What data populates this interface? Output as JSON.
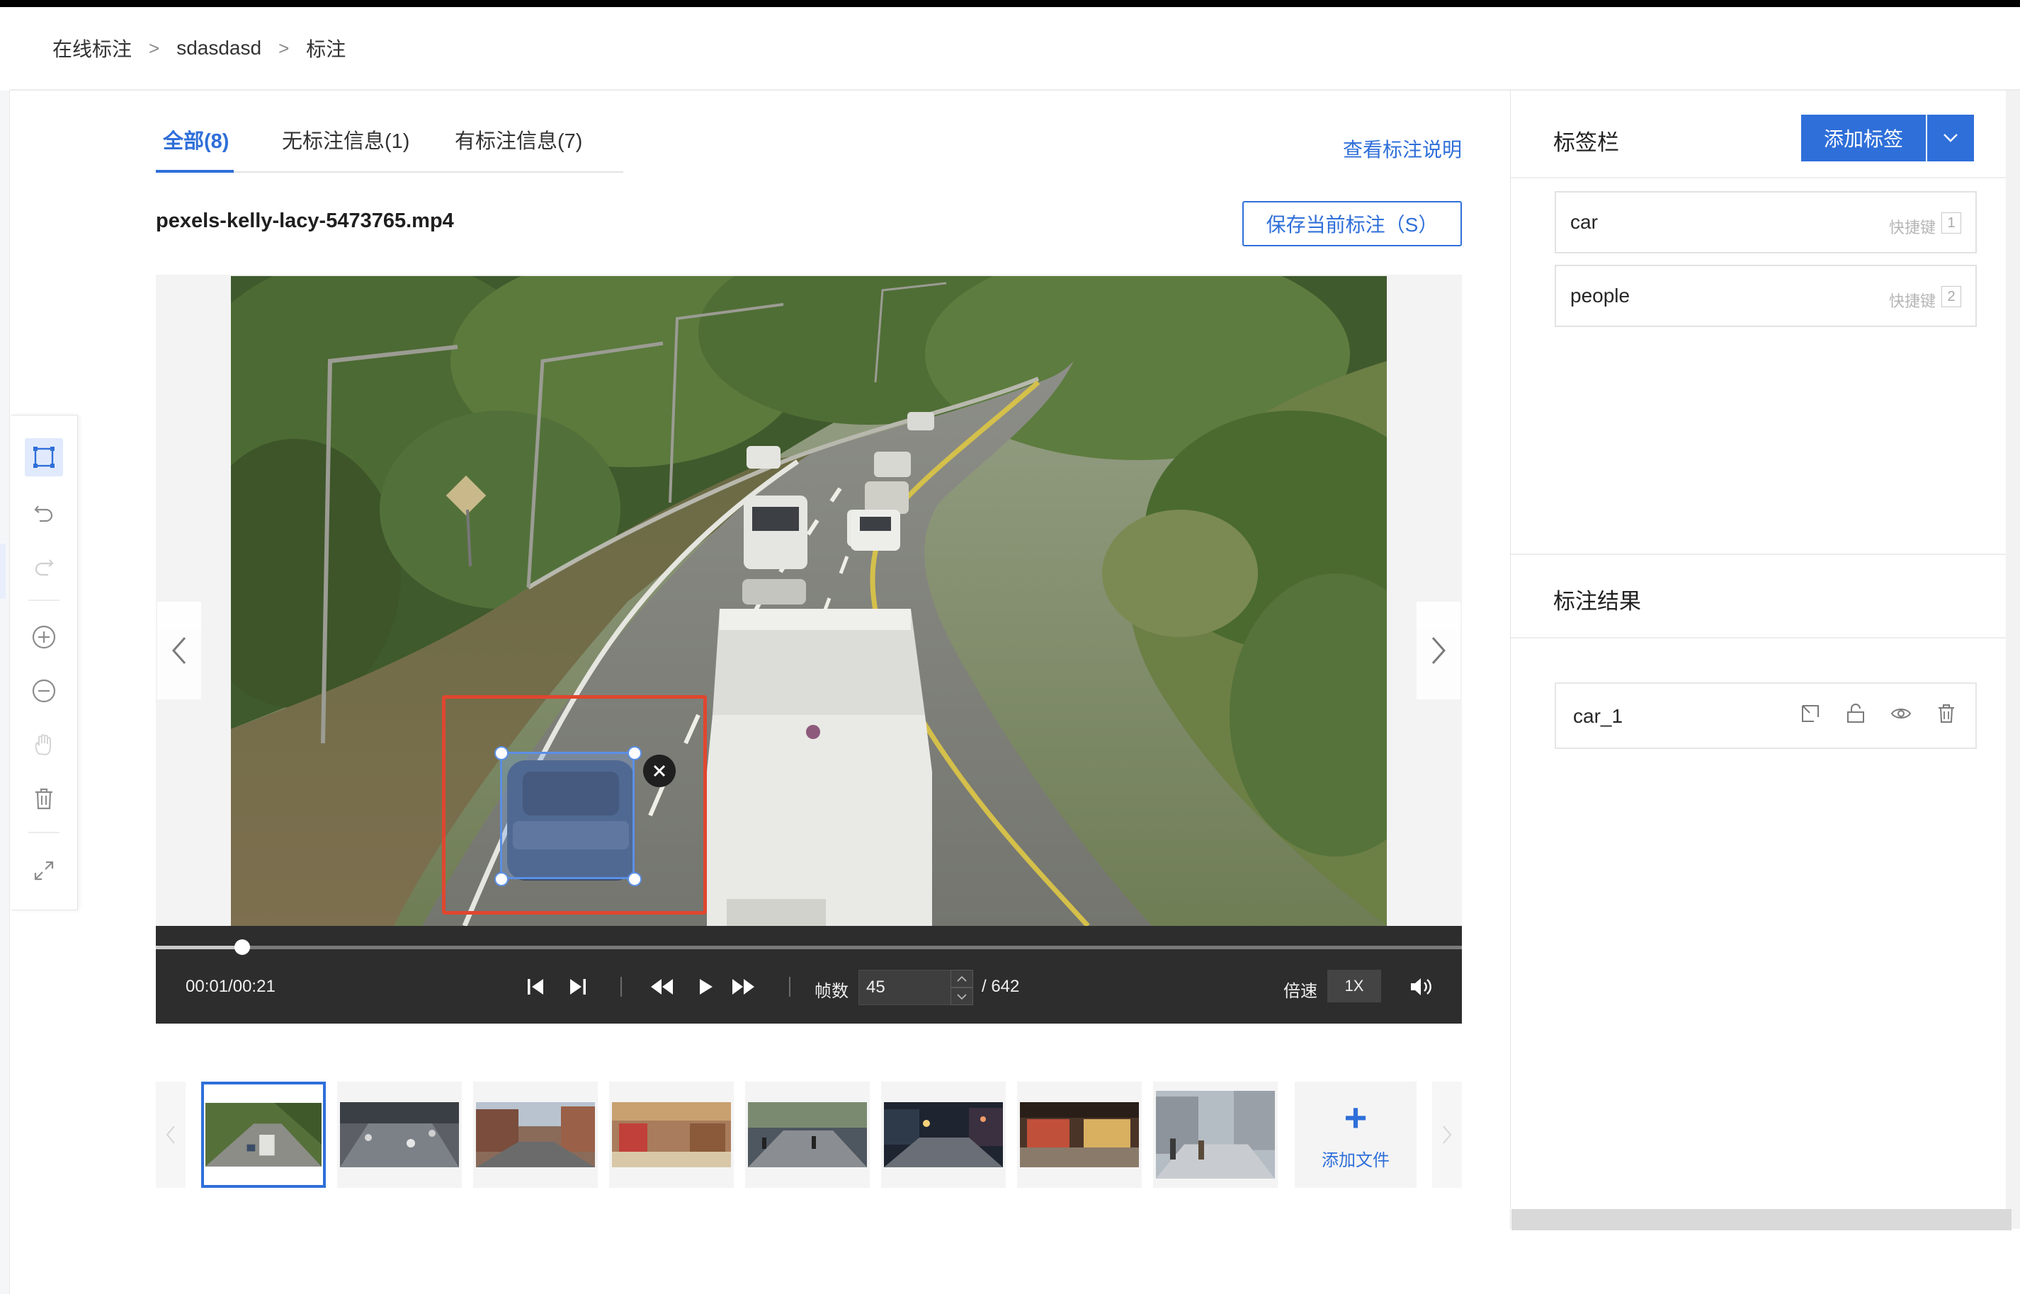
{
  "breadcrumb": {
    "items": [
      "在线标注",
      "sdasdasd",
      "标注"
    ],
    "separator": ">"
  },
  "tabs": [
    {
      "label": "全部(8)",
      "active": true
    },
    {
      "label": "无标注信息(1)",
      "active": false
    },
    {
      "label": "有标注信息(7)",
      "active": false
    }
  ],
  "help_link": "查看标注说明",
  "file": {
    "name": "pexels-kelly-lacy-5473765.mp4"
  },
  "save_button": "保存当前标注（S）",
  "toolbar_icons": [
    "rectangle-tool-icon",
    "undo-icon",
    "redo-icon",
    "zoom-in-icon",
    "zoom-out-icon",
    "hand-pan-icon",
    "delete-icon",
    "fullscreen-icon"
  ],
  "player": {
    "time": "00:01/00:21",
    "progress": 0.066,
    "frame_label": "帧数",
    "frame_value": "45",
    "frame_total": "/ 642",
    "speed_label": "倍速",
    "speed_value": "1X"
  },
  "thumbnails": {
    "count": 8,
    "active_index": 0,
    "add_file_label": "添加文件",
    "add_file_icon": "+"
  },
  "right_panel": {
    "tags_title": "标签栏",
    "add_tag_label": "添加标签",
    "tags": [
      {
        "name": "car",
        "hotkey_label": "快捷键",
        "hotkey": "1"
      },
      {
        "name": "people",
        "hotkey_label": "快捷键",
        "hotkey": "2"
      }
    ],
    "results_title": "标注结果",
    "results": [
      {
        "name": "car_1"
      }
    ]
  },
  "colors": {
    "accent": "#2f6fd9",
    "selection_box": "#e0462f",
    "annotation_box": "#5b8fe6",
    "player_bg": "#2d2d2d"
  }
}
